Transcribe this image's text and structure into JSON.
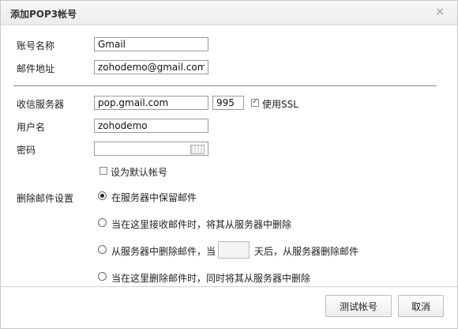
{
  "dialog": {
    "title": "添加POP3帐号",
    "close_glyph": "×"
  },
  "account": {
    "name_label": "账号名称",
    "name_value": "Gmail",
    "email_label": "邮件地址",
    "email_value": "zohodemo@gmail.com"
  },
  "server": {
    "incoming_label": "收信服务器",
    "host_value": "pop.gmail.com",
    "port_value": "995",
    "ssl_label": "使用SSL",
    "ssl_checked": true,
    "username_label": "用户名",
    "username_value": "zohodemo",
    "password_label": "密码",
    "password_value": "",
    "default_label": "设为默认帐号",
    "default_checked": false
  },
  "delete": {
    "label": "删除邮件设置",
    "options": [
      {
        "text": "在服务器中保留邮件",
        "selected": true
      },
      {
        "text": "当在这里接收邮件时，将其从服务器中删除",
        "selected": false
      },
      {
        "text_before": "从服务器中删除邮件，当",
        "days_value": "",
        "text_after": "天后，从服务器删除邮件",
        "selected": false
      },
      {
        "text": "当在这里删除邮件时，同时将其从服务器中删除",
        "selected": false
      }
    ]
  },
  "buttons": {
    "test": "测试帐号",
    "cancel": "取消"
  }
}
